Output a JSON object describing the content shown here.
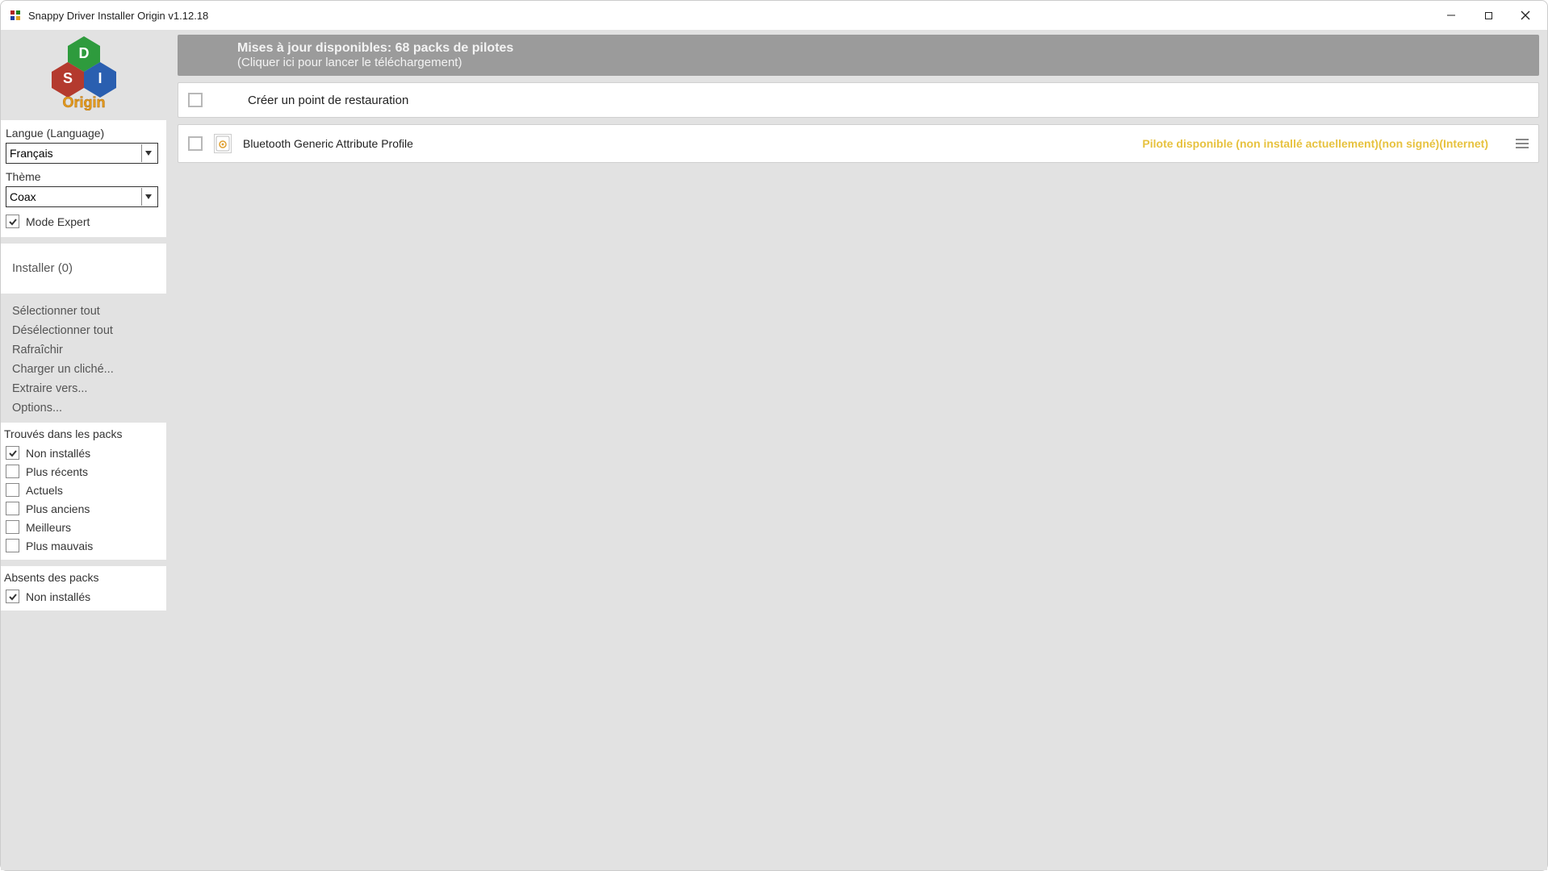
{
  "window": {
    "title": "Snappy Driver Installer Origin v1.12.18"
  },
  "sidebar": {
    "language_label": "Langue (Language)",
    "language_value": "Français",
    "theme_label": "Thème",
    "theme_value": "Coax",
    "expert_mode": "Mode Expert",
    "install_label": "Installer (0)",
    "actions": {
      "select_all": "Sélectionner tout",
      "deselect_all": "Désélectionner tout",
      "refresh": "Rafraîchir",
      "load_snapshot": "Charger un cliché...",
      "extract_to": "Extraire vers...",
      "options": "Options..."
    },
    "found_in_packs": {
      "title": "Trouvés dans les packs",
      "not_installed": "Non installés",
      "newer": "Plus récents",
      "current": "Actuels",
      "older": "Plus anciens",
      "better": "Meilleurs",
      "worse": "Plus mauvais"
    },
    "missing_in_packs": {
      "title": "Absents des packs",
      "not_installed": "Non installés"
    }
  },
  "content": {
    "banner_line1": "Mises à jour disponibles: 68 packs de pilotes",
    "banner_line2": "(Cliquer ici pour lancer le téléchargement)",
    "restore_point": "Créer un point de restauration",
    "driver": {
      "name": "Bluetooth Generic Attribute Profile",
      "status": "Pilote disponible (non installé actuellement)(non signé)(Internet)"
    }
  }
}
